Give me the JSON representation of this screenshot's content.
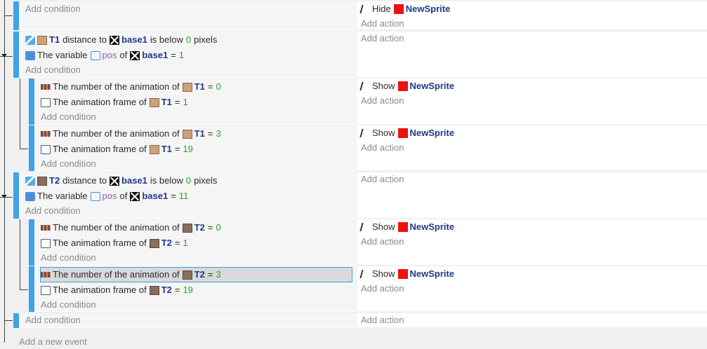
{
  "labels": {
    "add_condition": "Add condition",
    "add_action": "Add action",
    "add_new_event": "Add a new event",
    "distance_to": "distance to",
    "is_below": "is below",
    "pixels": "pixels",
    "the_variable": "The variable",
    "of": "of",
    "anim_number": "The number of the animation of",
    "anim_frame": "The animation frame of",
    "equals": "=",
    "hide": "Hide",
    "show": "Show"
  },
  "objects": {
    "t1": "T1",
    "t2": "T2",
    "base": "base1",
    "sprite": "NewSprite",
    "pos_var": "pos"
  },
  "values": {
    "zero": "0",
    "one": "1",
    "three": "3",
    "eleven": "11",
    "nineteen": "19"
  }
}
